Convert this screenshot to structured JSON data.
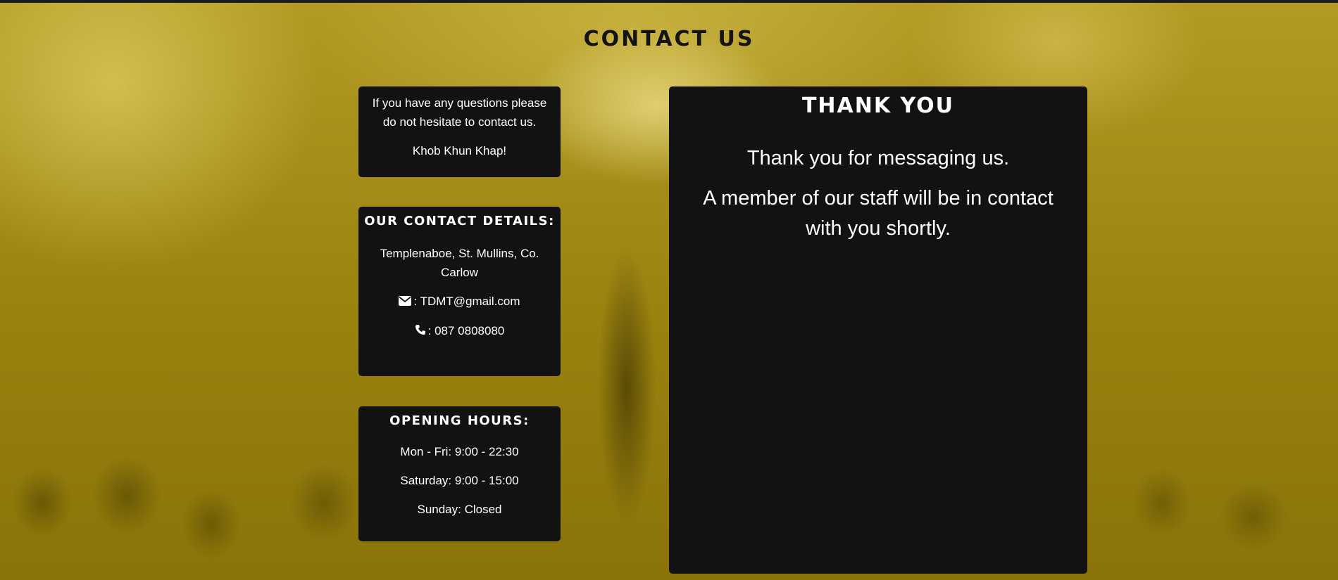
{
  "page": {
    "title": "CONTACT US"
  },
  "intro": {
    "text": "If you have any questions please do not hesitate to contact us.",
    "greeting": "Khob Khun Khap!"
  },
  "contact": {
    "heading": "OUR CONTACT DETAILS:",
    "address": "Templenaboe, St. Mullins, Co. Carlow",
    "email_icon": "envelope-icon",
    "email": ": TDMT@gmail.com",
    "phone_icon": "phone-icon",
    "phone": ": 087 0808080"
  },
  "hours": {
    "heading": "OPENING HOURS:",
    "weekdays": "Mon - Fri: 9:00 - 22:30",
    "saturday": "Saturday: 9:00 - 15:00",
    "sunday": "Sunday: Closed"
  },
  "thanks": {
    "heading": "THANK YOU",
    "line1": "Thank you for messaging us.",
    "line2": "A member of our staff will be in contact with you shortly."
  },
  "colors": {
    "background": "#9c8410",
    "card": "#121212",
    "title_text": "#141414",
    "card_text": "#ffffff"
  }
}
